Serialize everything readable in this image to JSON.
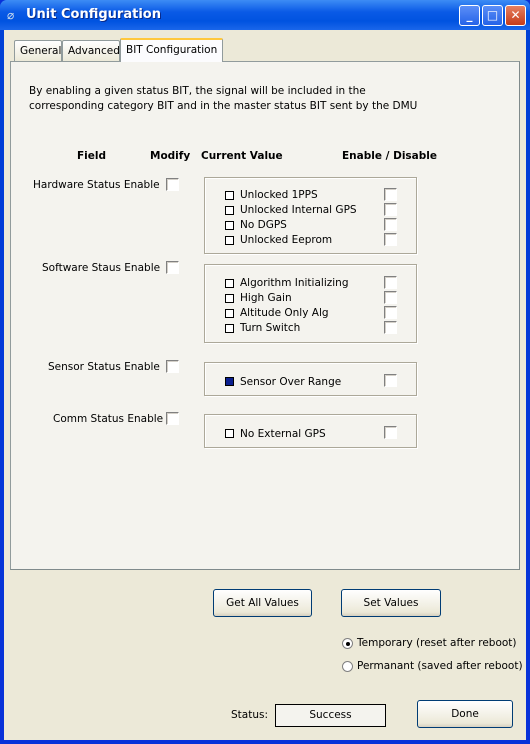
{
  "window": {
    "title": "Unit Configuration"
  },
  "tabs": [
    {
      "label": "General"
    },
    {
      "label": "Advanced"
    },
    {
      "label": "BIT Configuration",
      "active": true
    }
  ],
  "description": [
    "By enabling a given status BIT,  the signal will be included in the",
    "corresponding category BIT and in the  master status BIT sent by the DMU"
  ],
  "headers": {
    "field": "Field",
    "modify": "Modify",
    "current_value": "Current Value",
    "enable_disable": "Enable / Disable"
  },
  "groups": [
    {
      "field": "Hardware Status Enable",
      "modify": false,
      "items": [
        {
          "label": "Unlocked 1PPS",
          "value": false,
          "enabled": false
        },
        {
          "label": "Unlocked Internal GPS",
          "value": false,
          "enabled": false
        },
        {
          "label": "No DGPS",
          "value": false,
          "enabled": false
        },
        {
          "label": "Unlocked Eeprom",
          "value": false,
          "enabled": false
        }
      ]
    },
    {
      "field": "Software Staus Enable",
      "modify": false,
      "items": [
        {
          "label": "Algorithm Initializing",
          "value": false,
          "enabled": false
        },
        {
          "label": "High Gain",
          "value": false,
          "enabled": false
        },
        {
          "label": "Altitude Only Alg",
          "value": false,
          "enabled": false
        },
        {
          "label": "Turn Switch",
          "value": false,
          "enabled": false
        }
      ]
    },
    {
      "field": "Sensor Status Enable",
      "modify": false,
      "items": [
        {
          "label": "Sensor Over Range",
          "value": true,
          "enabled": false
        }
      ]
    },
    {
      "field": "Comm Status Enable",
      "modify": false,
      "items": [
        {
          "label": "No External GPS",
          "value": false,
          "enabled": false
        }
      ]
    }
  ],
  "buttons": {
    "get_all": "Get All Values",
    "set": "Set Values",
    "done": "Done"
  },
  "mode": {
    "options": [
      "Temporary (reset after reboot)",
      "Permanant (saved after reboot)"
    ],
    "selected": 0
  },
  "status": {
    "label": "Status:",
    "value": "Success"
  },
  "colors": {
    "title_bar": "#0a5ae6",
    "face": "#ece9d8",
    "value_on": "#0a1f8f"
  }
}
